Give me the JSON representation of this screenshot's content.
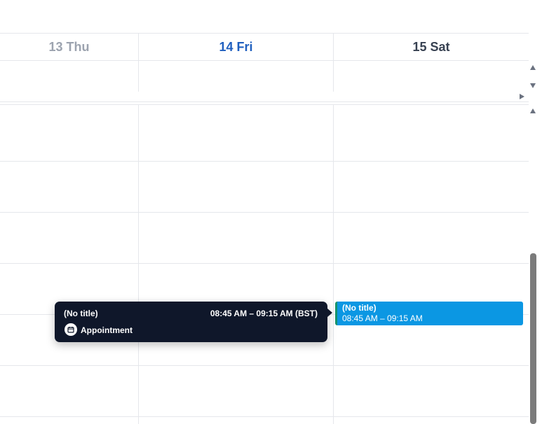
{
  "calendar": {
    "days": [
      {
        "label": "13 Thu",
        "state": "past"
      },
      {
        "label": "14 Fri",
        "state": "today"
      },
      {
        "label": "15 Sat",
        "state": "future"
      }
    ]
  },
  "event": {
    "title": "(No title)",
    "time": "08:45 AM – 09:15 AM",
    "color": "#0b97e3",
    "accent_color": "#16936b"
  },
  "tooltip": {
    "title": "(No title)",
    "time": "08:45 AM – 09:15 AM (BST)",
    "type": "Appointment",
    "type_icon": "calendar-icon"
  },
  "colors": {
    "today": "#1f5fbf",
    "past": "#9ca3af",
    "tooltip_bg": "#0f172a"
  }
}
